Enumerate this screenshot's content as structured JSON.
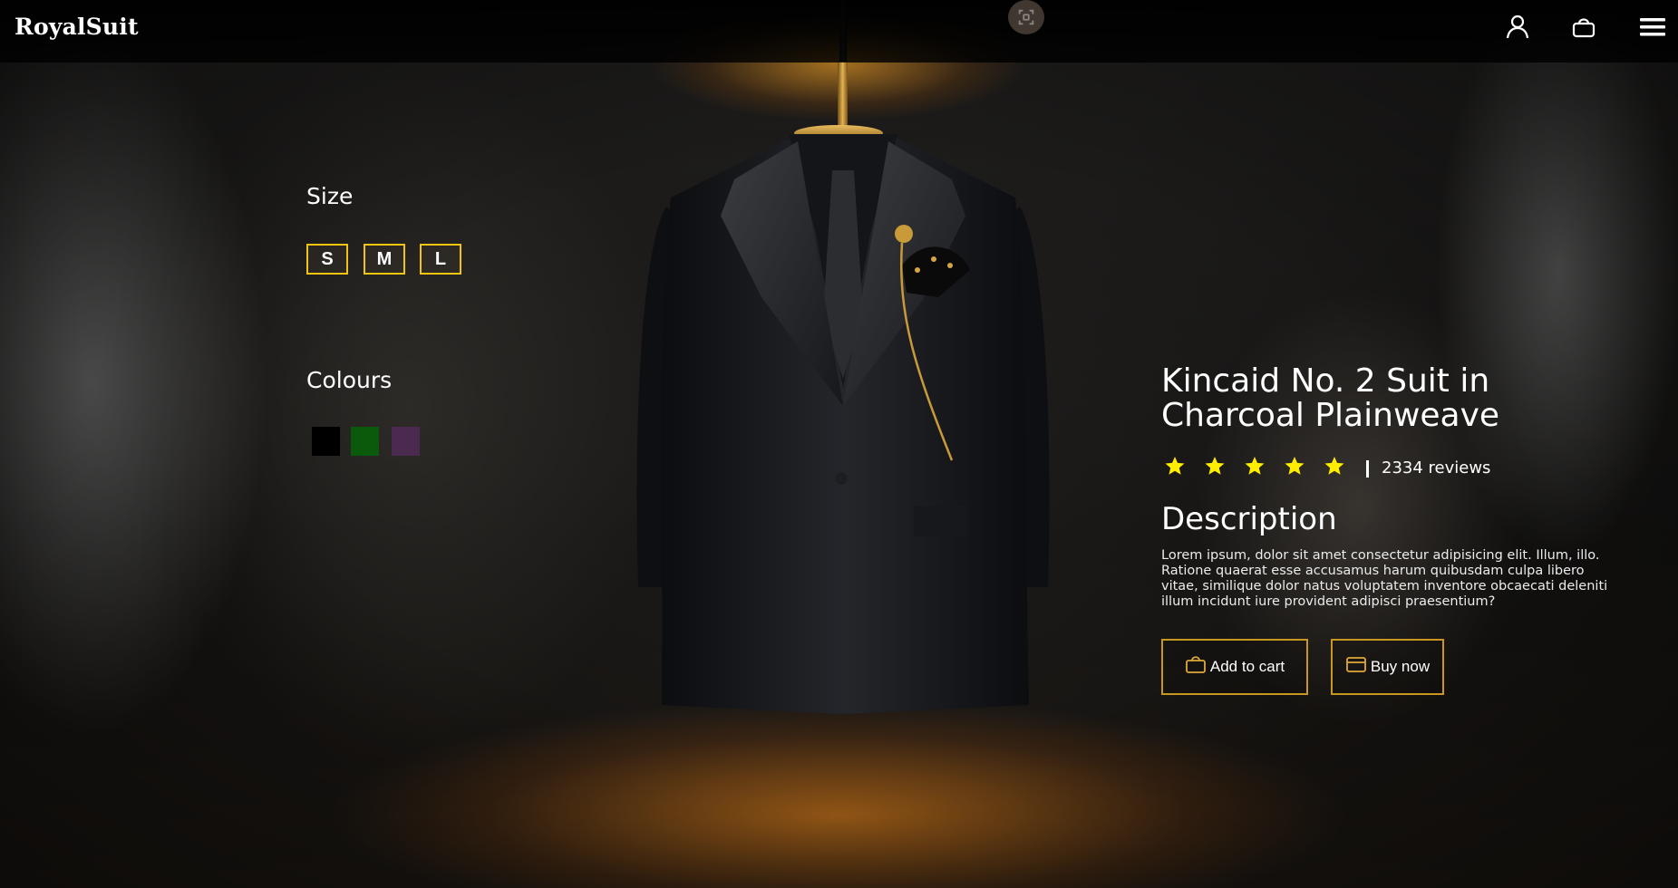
{
  "brand": {
    "name": "RoyalSuit"
  },
  "nav": {
    "icons": [
      "scan-icon",
      "user-icon",
      "shopping-bag-icon",
      "hamburger-menu-icon"
    ]
  },
  "options": {
    "size_title": "Size",
    "sizes": [
      "S",
      "M",
      "L"
    ],
    "colours_title": "Colours",
    "colours": [
      "#000000",
      "#0b5a0b",
      "#4a2b4f"
    ]
  },
  "product": {
    "title": "Kincaid No. 2 Suit in Charcoal Plainweave",
    "rating": 5,
    "rating_max": 5,
    "reviews_text": "2334 reviews",
    "description_title": "Description",
    "description": "Lorem ipsum, dolor sit amet consectetur adipisicing elit. Illum, illo. Ratione quaerat esse accusamus harum quibusdam culpa libero vitae, similique dolor natus voluptatem inventore obcaecati deleniti illum incidunt iure provident adipisci praesentium?"
  },
  "actions": {
    "add_to_cart": "Add to cart",
    "buy_now": "Buy now"
  },
  "colors": {
    "accent": "#f1c40f",
    "button_border": "#c9961f",
    "star": "#ffee00"
  }
}
